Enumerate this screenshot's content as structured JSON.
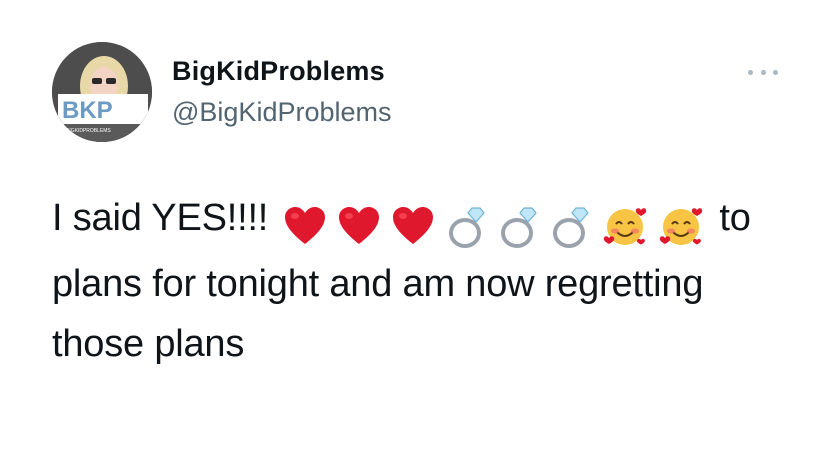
{
  "header": {
    "display_name": "BigKidProblems",
    "handle": "@BigKidProblems",
    "more_icon": "more-horizontal-icon"
  },
  "avatar": {
    "logo_text": "BKP",
    "logo_subtext": "BIGKIDPROBLEMS",
    "logo_color": "#6b9ac4"
  },
  "tweet": {
    "text_before": "I said YES!!!!",
    "emojis": [
      "red-heart",
      "red-heart",
      "red-heart",
      "ring",
      "ring",
      "ring",
      "smiling-face-with-hearts",
      "smiling-face-with-hearts"
    ],
    "text_after": "to plans for tonight and am now regretting those plans"
  },
  "colors": {
    "text": "#0f1419",
    "secondary": "#536471",
    "heart": "#e0182d",
    "ring_band": "#9aa3ad",
    "diamond": "#bfe6f7",
    "face": "#f7c443",
    "blush": "#f26c6c"
  }
}
